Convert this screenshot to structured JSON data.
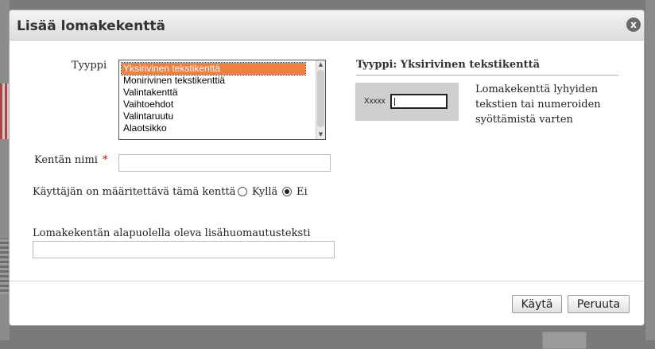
{
  "dialog": {
    "title": "Lisää lomakekenttä",
    "close_glyph": "x"
  },
  "form": {
    "type_label": "Tyyppi",
    "type_options": [
      "Yksirivinen tekstikenttä",
      "Monirivinen tekstikenttiä",
      "Valintakenttä",
      "Vaihtoehdot",
      "Valintaruutu",
      "Alaotsikko"
    ],
    "type_selected_index": 0,
    "field_name_label": "Kentän nimi",
    "required_marker": "*",
    "field_name_value": "",
    "required_question": "Käyttäjän on määritettävä tämä kenttä",
    "required_yes": "Kyllä",
    "required_no": "Ei",
    "required_selected": "Ei",
    "note_label": "Lomakekentän alapuolella oleva lisähuomautusteksti",
    "note_value": ""
  },
  "type_info": {
    "heading": "Tyyppi: Yksirivinen tekstikenttä",
    "preview_label": "Xxxxx",
    "description": "Lomakekenttä lyhyiden tekstien tai numeroiden syöttämistä varten"
  },
  "buttons": {
    "use": "Käytä",
    "cancel": "Peruuta"
  },
  "icons": {
    "close": "close-icon",
    "scroll_up": "chevron-up-icon",
    "scroll_down": "chevron-down-icon"
  },
  "colors": {
    "selection": "#f08040",
    "required": "#cc0000"
  }
}
